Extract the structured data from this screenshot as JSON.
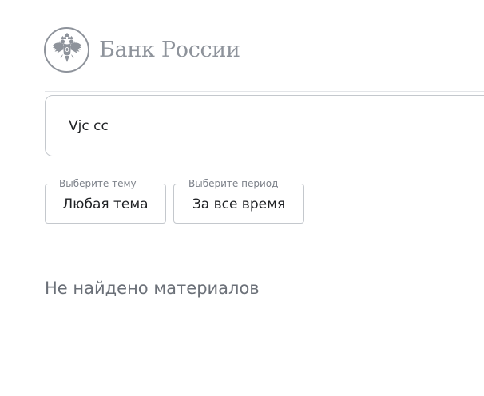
{
  "header": {
    "brand_name": "Банк России",
    "logo_icon": "double-headed-eagle-icon",
    "brand_color": "#8e939b"
  },
  "search": {
    "value": "Vjc cc",
    "placeholder": ""
  },
  "filters": {
    "topic": {
      "legend": "Выберите тему",
      "value": "Любая тема"
    },
    "period": {
      "legend": "Выберите период",
      "value": "За все время"
    }
  },
  "results": {
    "empty_message": "Не найдено материалов"
  },
  "colors": {
    "border": "#c4c8cd",
    "muted_text": "#6b7078",
    "text": "#1f2124"
  }
}
